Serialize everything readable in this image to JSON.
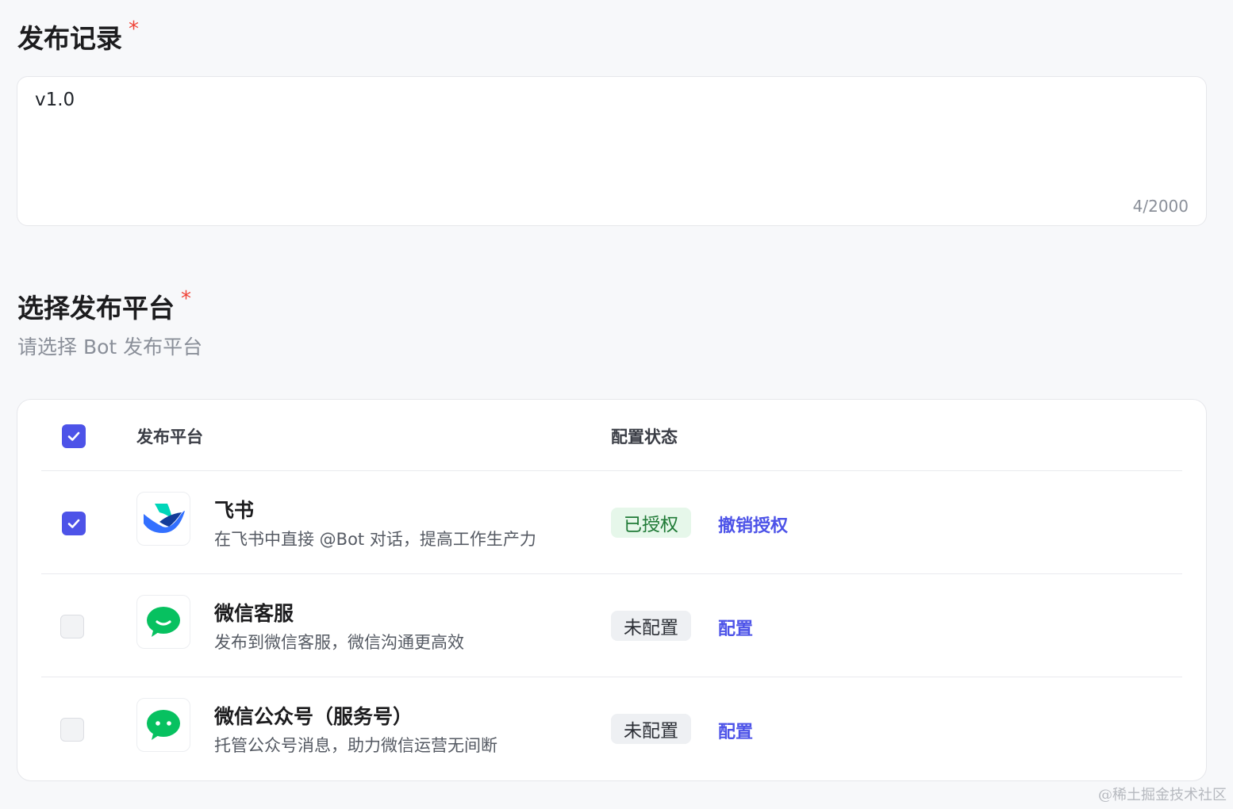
{
  "release_notes": {
    "title": "发布记录",
    "required_mark": "*",
    "value": "v1.0",
    "char_count": "4/2000"
  },
  "platforms": {
    "title": "选择发布平台",
    "required_mark": "*",
    "subtitle": "请选择 Bot 发布平台",
    "columns": {
      "platform": "发布平台",
      "status": "配置状态"
    },
    "items": [
      {
        "name": "飞书",
        "desc": "在飞书中直接 @Bot 对话，提高工作生产力",
        "status": "已授权",
        "action": "撤销授权",
        "checked": true,
        "icon": "feishu-logo"
      },
      {
        "name": "微信客服",
        "desc": "发布到微信客服，微信沟通更高效",
        "status": "未配置",
        "action": "配置",
        "checked": false,
        "icon": "wechat-kf-logo"
      },
      {
        "name": "微信公众号（服务号）",
        "desc": "托管公众号消息，助力微信运营无间断",
        "status": "未配置",
        "action": "配置",
        "checked": false,
        "icon": "wechat-mp-logo"
      }
    ]
  },
  "colors": {
    "accent": "#4d53e8",
    "required": "#f04438",
    "authorized_bg": "#e6f7ea",
    "authorized_text": "#1f7a36",
    "wechat_green": "#07c160"
  },
  "watermark": "@稀土掘金技术社区"
}
